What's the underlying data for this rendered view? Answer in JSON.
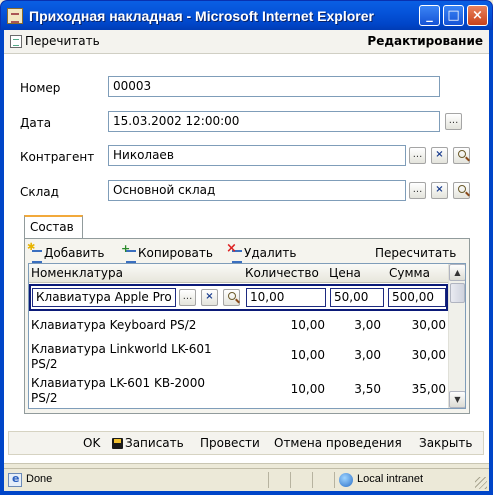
{
  "window": {
    "title": "Приходная накладная - Microsoft Internet Explorer",
    "minimize": "_",
    "maximize": "□",
    "close": "×"
  },
  "command_bar": {
    "refresh_label": "Перечитать",
    "mode_label": "Редактирование"
  },
  "form": {
    "number": {
      "label": "Номер",
      "value": "00003"
    },
    "date": {
      "label": "Дата",
      "value": "15.03.2002 12:00:00",
      "select_button": "..."
    },
    "counterparty": {
      "label": "Контрагент",
      "value": "Николаев",
      "select_button": "...",
      "clear_button": "×"
    },
    "warehouse": {
      "label": "Склад",
      "value": "Основной склад",
      "select_button": "...",
      "clear_button": "×"
    }
  },
  "tabs": [
    {
      "label": "Состав"
    }
  ],
  "table_toolbar": {
    "add": "Добавить",
    "copy": "Копировать",
    "delete": "Удалить",
    "recalc": "Пересчитать"
  },
  "table": {
    "columns": [
      "Номенклатура",
      "Количество",
      "Цена",
      "Сумма"
    ],
    "edit_row": {
      "item": "Клавиатура Apple Pro",
      "select_button": "...",
      "clear_button": "×",
      "quantity": "10,00",
      "price": "50,00",
      "sum": "500,00"
    },
    "rows": [
      {
        "item_line1": "Клавиатура Keyboard PS/2",
        "item_line2": "",
        "quantity": "10,00",
        "price": "3,00",
        "sum": "30,00"
      },
      {
        "item_line1": "Клавиатура Linkworld LK-601",
        "item_line2": "PS/2",
        "quantity": "10,00",
        "price": "3,00",
        "sum": "30,00"
      },
      {
        "item_line1": "Клавиатура LK-601 KB-2000",
        "item_line2": "PS/2",
        "quantity": "10,00",
        "price": "3,50",
        "sum": "35,00"
      }
    ],
    "scroll_up": "▲",
    "scroll_down": "▼"
  },
  "actions": {
    "ok": "OK",
    "save": "Записать",
    "post": "Провести",
    "unpost": "Отмена проведения",
    "close": "Закрыть"
  },
  "status_bar": {
    "status": "Done",
    "zone": "Local intranet"
  }
}
